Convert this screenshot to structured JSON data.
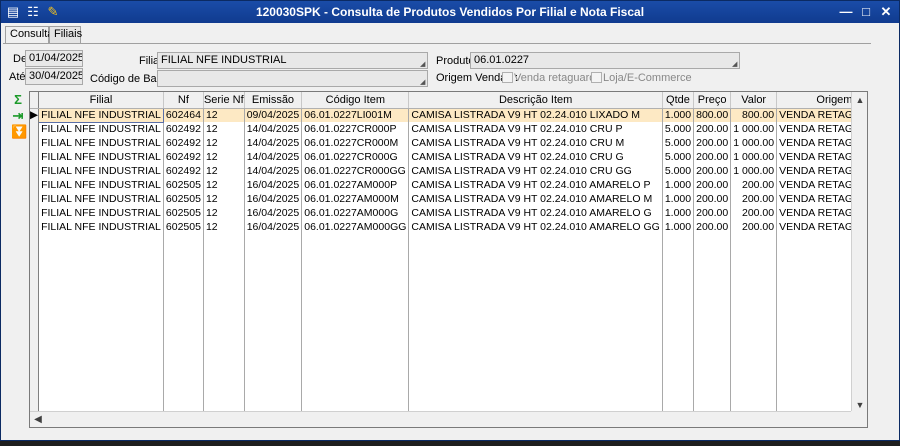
{
  "window": {
    "title": "120030SPK - Consulta de Produtos Vendidos Por Filial e Nota Fiscal",
    "icons": [
      "app-menu-icon",
      "traffic-light-icon",
      "pin-icon"
    ],
    "minimize": "—",
    "restore": "□",
    "close": "✕"
  },
  "tabs": [
    {
      "label": "Consulta",
      "active": true
    },
    {
      "label": "Filiais",
      "active": false
    }
  ],
  "filters": {
    "de_label": "De",
    "de_value": "01/04/2025",
    "ate_label": "Até",
    "ate_value": "30/04/2025",
    "filial_label": "Filial",
    "filial_value": "FILIAL NFE INDUSTRIAL",
    "codigo_barras_label": "Código de Barras",
    "codigo_barras_value": "",
    "produto_label": "Produto",
    "produto_value": "06.01.0227",
    "origem_label": "Origem Vendas :",
    "venda_retaguarda_label": "Venda retaguarda",
    "loja_ecommerce_label": "Loja/E-Commerce"
  },
  "sidebar_icons": [
    "sum-icon",
    "export-icon",
    "download-icon"
  ],
  "grid": {
    "columns": [
      "Filial",
      "Nf",
      "Serie Nf",
      "Emissão",
      "Código Item",
      "Descrição Item",
      "Qtde",
      "Preço",
      "Valor",
      "Origem"
    ],
    "rows": [
      [
        "FILIAL NFE INDUSTRIAL",
        "602464",
        "12",
        "09/04/2025",
        "06.01.0227LI001M",
        "CAMISA LISTRADA V9 HT 02.24.010 LIXADO M",
        "1.000",
        "800.00",
        "800.00",
        "VENDA RETAGUARDA"
      ],
      [
        "FILIAL NFE INDUSTRIAL",
        "602492",
        "12",
        "14/04/2025",
        "06.01.0227CR000P",
        "CAMISA LISTRADA V9 HT 02.24.010 CRU P",
        "5.000",
        "200.00",
        "1 000.00",
        "VENDA RETAGUARDA"
      ],
      [
        "FILIAL NFE INDUSTRIAL",
        "602492",
        "12",
        "14/04/2025",
        "06.01.0227CR000M",
        "CAMISA LISTRADA V9 HT 02.24.010 CRU M",
        "5.000",
        "200.00",
        "1 000.00",
        "VENDA RETAGUARDA"
      ],
      [
        "FILIAL NFE INDUSTRIAL",
        "602492",
        "12",
        "14/04/2025",
        "06.01.0227CR000G",
        "CAMISA LISTRADA V9 HT 02.24.010 CRU G",
        "5.000",
        "200.00",
        "1 000.00",
        "VENDA RETAGUARDA"
      ],
      [
        "FILIAL NFE INDUSTRIAL",
        "602492",
        "12",
        "14/04/2025",
        "06.01.0227CR000GG",
        "CAMISA LISTRADA V9 HT 02.24.010 CRU GG",
        "5.000",
        "200.00",
        "1 000.00",
        "VENDA RETAGUARDA"
      ],
      [
        "FILIAL NFE INDUSTRIAL",
        "602505",
        "12",
        "16/04/2025",
        "06.01.0227AM000P",
        "CAMISA LISTRADA V9 HT 02.24.010 AMARELO P",
        "1.000",
        "200.00",
        "200.00",
        "VENDA RETAGUARDA"
      ],
      [
        "FILIAL NFE INDUSTRIAL",
        "602505",
        "12",
        "16/04/2025",
        "06.01.0227AM000M",
        "CAMISA LISTRADA V9 HT 02.24.010 AMARELO M",
        "1.000",
        "200.00",
        "200.00",
        "VENDA RETAGUARDA"
      ],
      [
        "FILIAL NFE INDUSTRIAL",
        "602505",
        "12",
        "16/04/2025",
        "06.01.0227AM000G",
        "CAMISA LISTRADA V9 HT 02.24.010 AMARELO G",
        "1.000",
        "200.00",
        "200.00",
        "VENDA RETAGUARDA"
      ],
      [
        "FILIAL NFE INDUSTRIAL",
        "602505",
        "12",
        "16/04/2025",
        "06.01.0227AM000GG",
        "CAMISA LISTRADA V9 HT 02.24.010 AMARELO GG",
        "1.000",
        "200.00",
        "200.00",
        "VENDA RETAGUARDA"
      ]
    ],
    "selected_row": 0
  },
  "colors": {
    "titlebar": "#1a4ca8",
    "selected_row": "#fde9c4",
    "icon_green": "#1c9a2a"
  }
}
